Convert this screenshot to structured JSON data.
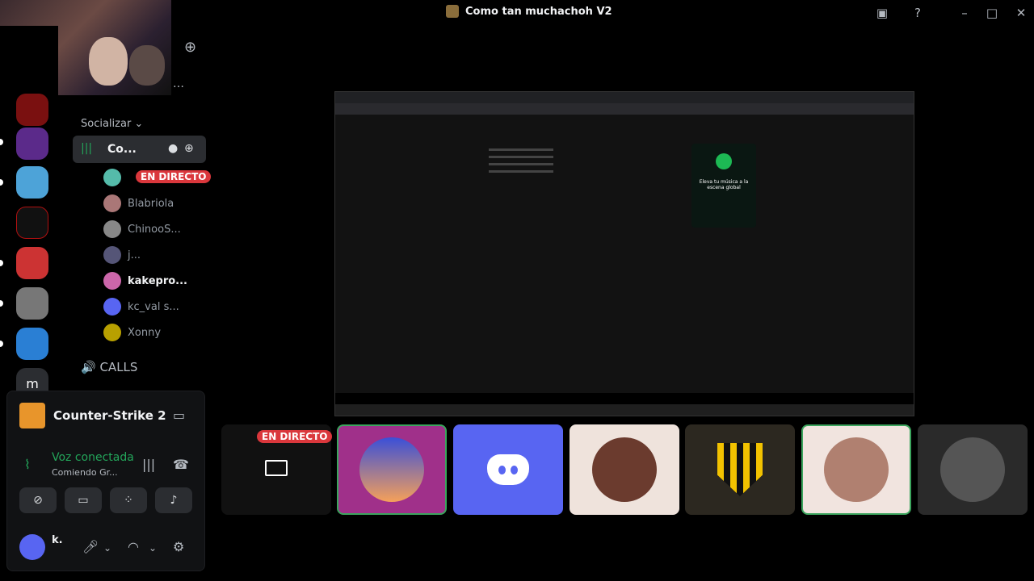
{
  "window": {
    "title": "Como tan muchachoh V2"
  },
  "sidebar": {
    "category": "Socializar",
    "active_channel": "Co...",
    "members": [
      {
        "name": "",
        "badge": "EN DIRECTO"
      },
      {
        "name": "Blabriola"
      },
      {
        "name": "ChinooS..."
      },
      {
        "name": "j..."
      },
      {
        "name": "kakepro..."
      },
      {
        "name": "kc_val s..."
      },
      {
        "name": "Xonny"
      }
    ],
    "calls_channel": "CALLS"
  },
  "game_panel": {
    "game": "Counter-Strike 2",
    "voice_status": "Voz conectada",
    "voice_channel": "Comiendo Gr..."
  },
  "user": {
    "name": "k."
  },
  "stage": {
    "card_title": "Eleva tu música a la escena global"
  },
  "tiles": {
    "live_label": "EN DIRECTO"
  },
  "colors": {
    "accent": "#5865f2",
    "live": "#da373c",
    "connected": "#23a55a"
  }
}
